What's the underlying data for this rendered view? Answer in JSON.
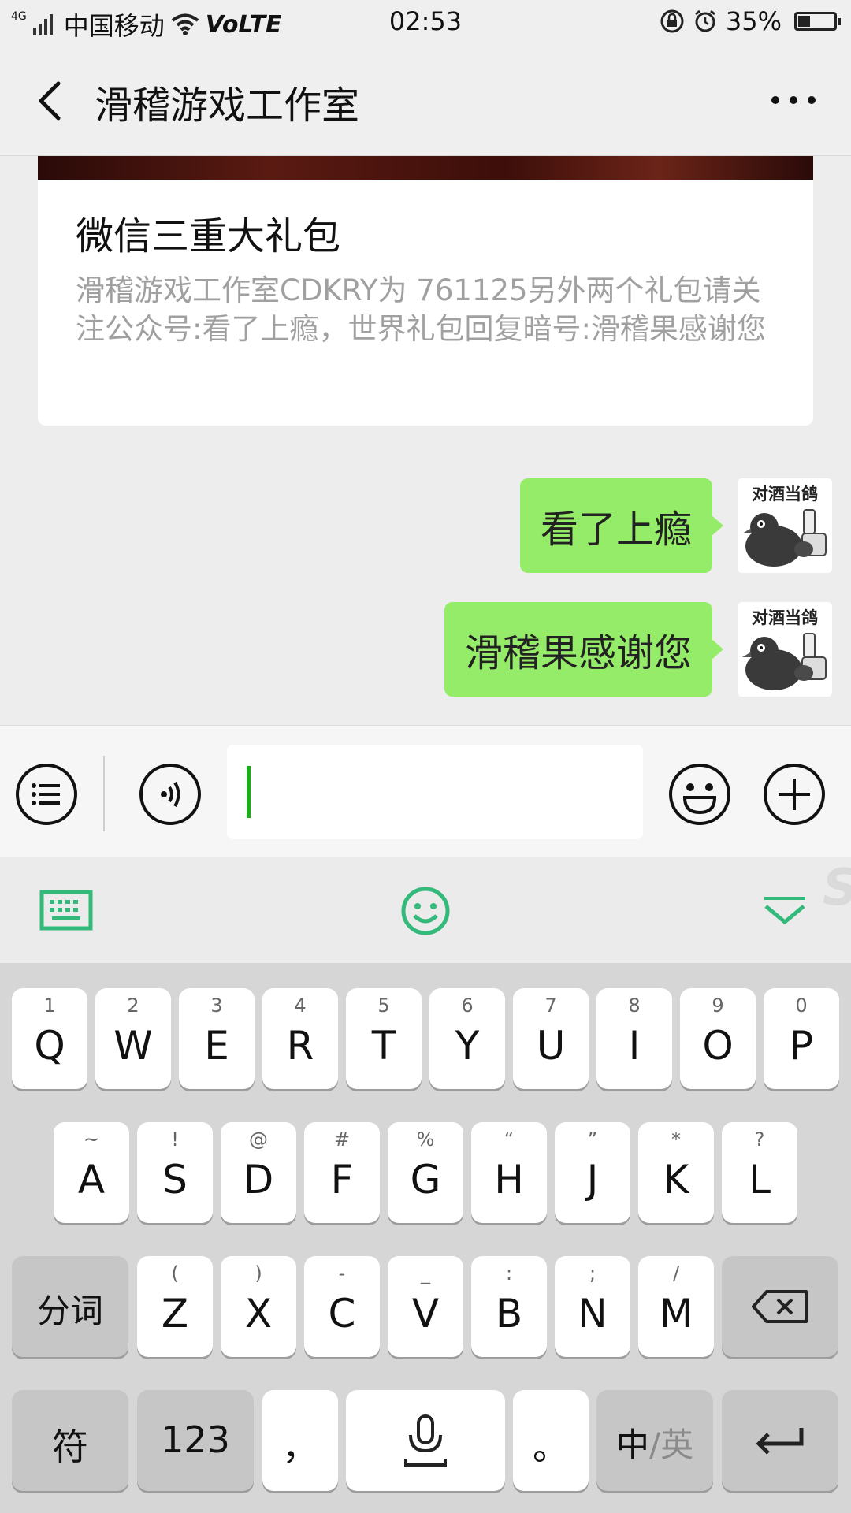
{
  "status_bar": {
    "network": "4G",
    "carrier": "中国移动",
    "volte": "VoLTE",
    "time": "02:53",
    "battery": "35%",
    "battery_level": 0.35
  },
  "nav": {
    "title": "滑稽游戏工作室",
    "back_icon": "chevron-left-icon",
    "more_icon": "more-dots-icon"
  },
  "card": {
    "title": "微信三重大礼包",
    "description": "滑稽游戏工作室CDKRY为 761125另外两个礼包请关注公众号:看了上瘾，世界礼包回复暗号:滑稽果感谢您"
  },
  "messages": [
    {
      "text": "看了上瘾",
      "avatar_caption": "对酒当鸽"
    },
    {
      "text": "滑稽果感谢您",
      "avatar_caption": "对酒当鸽"
    }
  ],
  "input_bar": {
    "menu_icon": "list-menu-icon",
    "voice_icon": "voice-icon",
    "input_value": "",
    "emoji_icon": "emoji-icon",
    "plus_icon": "plus-icon",
    "accent": "#1aad19"
  },
  "keyboard_toolbar": {
    "keyboard_icon": "keyboard-icon",
    "emoji_icon": "smiley-icon",
    "collapse_icon": "collapse-down-icon",
    "accent": "#33b97a"
  },
  "keyboard": {
    "row1": [
      {
        "hint": "1",
        "key": "Q"
      },
      {
        "hint": "2",
        "key": "W"
      },
      {
        "hint": "3",
        "key": "E"
      },
      {
        "hint": "4",
        "key": "R"
      },
      {
        "hint": "5",
        "key": "T"
      },
      {
        "hint": "6",
        "key": "Y"
      },
      {
        "hint": "7",
        "key": "U"
      },
      {
        "hint": "8",
        "key": "I"
      },
      {
        "hint": "9",
        "key": "O"
      },
      {
        "hint": "0",
        "key": "P"
      }
    ],
    "row2": [
      {
        "hint": "~",
        "key": "A"
      },
      {
        "hint": "!",
        "key": "S"
      },
      {
        "hint": "@",
        "key": "D"
      },
      {
        "hint": "#",
        "key": "F"
      },
      {
        "hint": "%",
        "key": "G"
      },
      {
        "hint": "“",
        "key": "H"
      },
      {
        "hint": "”",
        "key": "J"
      },
      {
        "hint": "*",
        "key": "K"
      },
      {
        "hint": "?",
        "key": "L"
      }
    ],
    "row3": [
      {
        "hint": "(",
        "key": "Z"
      },
      {
        "hint": ")",
        "key": "X"
      },
      {
        "hint": "-",
        "key": "C"
      },
      {
        "hint": "_",
        "key": "V"
      },
      {
        "hint": ":",
        "key": "B"
      },
      {
        "hint": ";",
        "key": "N"
      },
      {
        "hint": "/",
        "key": "M"
      }
    ],
    "fenci": "分词",
    "backspace_icon": "backspace-icon",
    "symbols": "符",
    "numbers": "123",
    "comma": "，",
    "mic_icon": "microphone-icon",
    "period": "。",
    "lang_zh": "中",
    "lang_sep": "/",
    "lang_en": "英",
    "enter_icon": "enter-icon"
  }
}
